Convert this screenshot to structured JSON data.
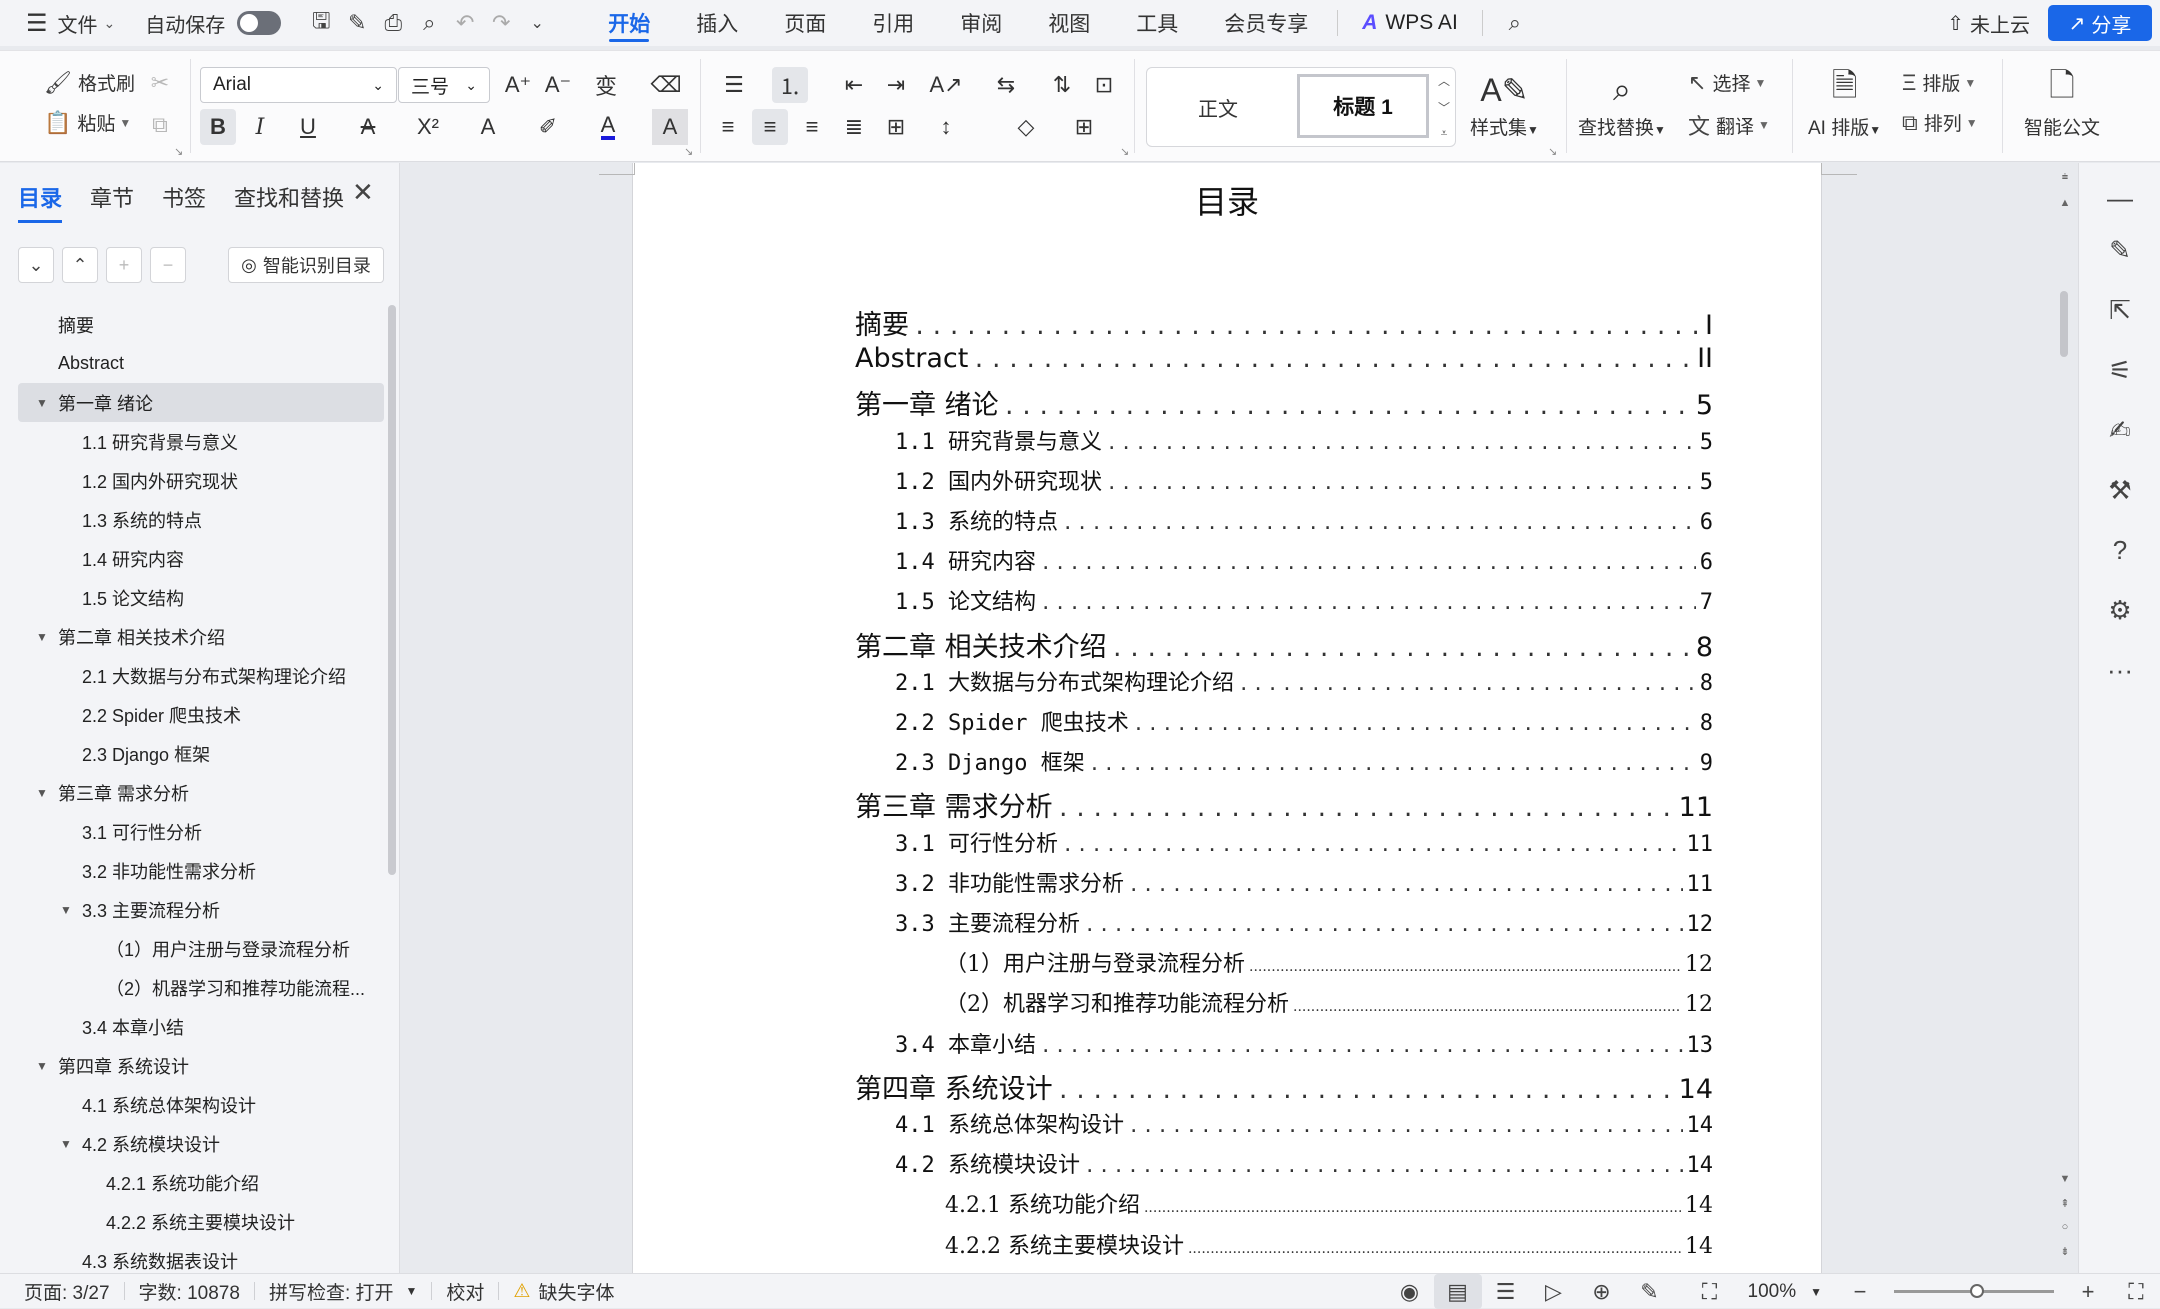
{
  "menubar": {
    "file": "文件",
    "autosave": "自动保存",
    "tabs": [
      "开始",
      "插入",
      "页面",
      "引用",
      "审阅",
      "视图",
      "工具",
      "会员专享"
    ],
    "active_tab": "开始",
    "wps_ai": "WPS AI",
    "cloud": "未上云",
    "share": "分享"
  },
  "ribbon": {
    "format_painter": "格式刷",
    "paste": "粘贴",
    "font_name": "Arial",
    "font_size": "三号",
    "styles": {
      "normal": "正文",
      "heading1": "标题 1"
    },
    "style_set": "样式集",
    "find_replace": "查找替换",
    "select": "选择",
    "translate": "翻译",
    "ai_layout": "AI 排版",
    "typeset": "排版",
    "arrange": "排列",
    "smart_doc": "智能公文",
    "accent_color": "#1a67e8",
    "font_color_bar": "#1a1adc"
  },
  "nav": {
    "tabs": [
      "目录",
      "章节",
      "书签",
      "查找和替换"
    ],
    "active_tab": "目录",
    "smart_toc": "智能识别目录",
    "items": [
      {
        "label": "摘要",
        "level": 0,
        "toggle": ""
      },
      {
        "label": "Abstract",
        "level": 0,
        "toggle": ""
      },
      {
        "label": "第一章  绪论",
        "level": 0,
        "toggle": "▼",
        "selected": true
      },
      {
        "label": "1.1 研究背景与意义",
        "level": 1,
        "toggle": ""
      },
      {
        "label": "1.2 国内外研究现状",
        "level": 1,
        "toggle": ""
      },
      {
        "label": "1.3 系统的特点",
        "level": 1,
        "toggle": ""
      },
      {
        "label": "1.4 研究内容",
        "level": 1,
        "toggle": ""
      },
      {
        "label": "1.5 论文结构",
        "level": 1,
        "toggle": ""
      },
      {
        "label": "第二章  相关技术介绍",
        "level": 0,
        "toggle": "▼"
      },
      {
        "label": "2.1  大数据与分布式架构理论介绍",
        "level": 1,
        "toggle": ""
      },
      {
        "label": "2.2 Spider 爬虫技术",
        "level": 1,
        "toggle": ""
      },
      {
        "label": "2.3 Django 框架",
        "level": 1,
        "toggle": ""
      },
      {
        "label": "第三章  需求分析",
        "level": 0,
        "toggle": "▼"
      },
      {
        "label": "3.1 可行性分析",
        "level": 1,
        "toggle": ""
      },
      {
        "label": "3.2  非功能性需求分析",
        "level": 1,
        "toggle": ""
      },
      {
        "label": "3.3 主要流程分析",
        "level": 1,
        "toggle": "▼"
      },
      {
        "label": "（1）用户注册与登录流程分析",
        "level": 2,
        "toggle": ""
      },
      {
        "label": "（2）机器学习和推荐功能流程...",
        "level": 2,
        "toggle": ""
      },
      {
        "label": "3.4 本章小结",
        "level": 1,
        "toggle": ""
      },
      {
        "label": "第四章  系统设计",
        "level": 0,
        "toggle": "▼"
      },
      {
        "label": "4.1  系统总体架构设计",
        "level": 1,
        "toggle": ""
      },
      {
        "label": "4.2  系统模块设计",
        "level": 1,
        "toggle": "▼"
      },
      {
        "label": "4.2.1 系统功能介绍",
        "level": 2,
        "toggle": ""
      },
      {
        "label": "4.2.2 系统主要模块设计",
        "level": 2,
        "toggle": ""
      },
      {
        "label": "4.3  系统数据表设计",
        "level": 1,
        "toggle": ""
      }
    ]
  },
  "document": {
    "title": "目录",
    "toc": [
      {
        "text": "摘要",
        "page": "I",
        "level": 1
      },
      {
        "text": "Abstract",
        "page": "II",
        "level": 1
      },
      {
        "text": "第一章 绪论",
        "page": "5",
        "level": 1
      },
      {
        "text": "1.1 研究背景与意义",
        "page": "5",
        "level": 2
      },
      {
        "text": "1.2 国内外研究现状",
        "page": "5",
        "level": 2
      },
      {
        "text": "1.3 系统的特点",
        "page": "6",
        "level": 2
      },
      {
        "text": "1.4 研究内容",
        "page": "6",
        "level": 2
      },
      {
        "text": "1.5 论文结构",
        "page": "7",
        "level": 2
      },
      {
        "text": "第二章 相关技术介绍",
        "page": "8",
        "level": 1
      },
      {
        "text": "2.1 大数据与分布式架构理论介绍",
        "page": "8",
        "level": 2
      },
      {
        "text": "2.2 Spider 爬虫技术",
        "page": "8",
        "level": 2
      },
      {
        "text": "2.3 Django 框架",
        "page": "9",
        "level": 2
      },
      {
        "text": "第三章 需求分析",
        "page": "11",
        "level": 1
      },
      {
        "text": "3.1 可行性分析",
        "page": "11",
        "level": 2
      },
      {
        "text": "3.2 非功能性需求分析",
        "page": "11",
        "level": 2
      },
      {
        "text": "3.3 主要流程分析",
        "page": "12",
        "level": 2
      },
      {
        "text": "（1）用户注册与登录流程分析",
        "page": "12",
        "level": 3
      },
      {
        "text": "（2）机器学习和推荐功能流程分析",
        "page": "12",
        "level": 3
      },
      {
        "text": "3.4 本章小结",
        "page": "13",
        "level": 2
      },
      {
        "text": "第四章 系统设计",
        "page": "14",
        "level": 1
      },
      {
        "text": "4.1 系统总体架构设计",
        "page": "14",
        "level": 2
      },
      {
        "text": "4.2 系统模块设计",
        "page": "14",
        "level": 2
      },
      {
        "text": "4.2.1 系统功能介绍",
        "page": "14",
        "level": 3
      },
      {
        "text": "4.2.2 系统主要模块设计",
        "page": "14",
        "level": 3
      }
    ]
  },
  "status": {
    "page": "页面: 3/27",
    "words": "字数: 10878",
    "spell": "拼写检查: 打开",
    "proof": "校对",
    "missing_font": "缺失字体",
    "zoom": "100%"
  }
}
